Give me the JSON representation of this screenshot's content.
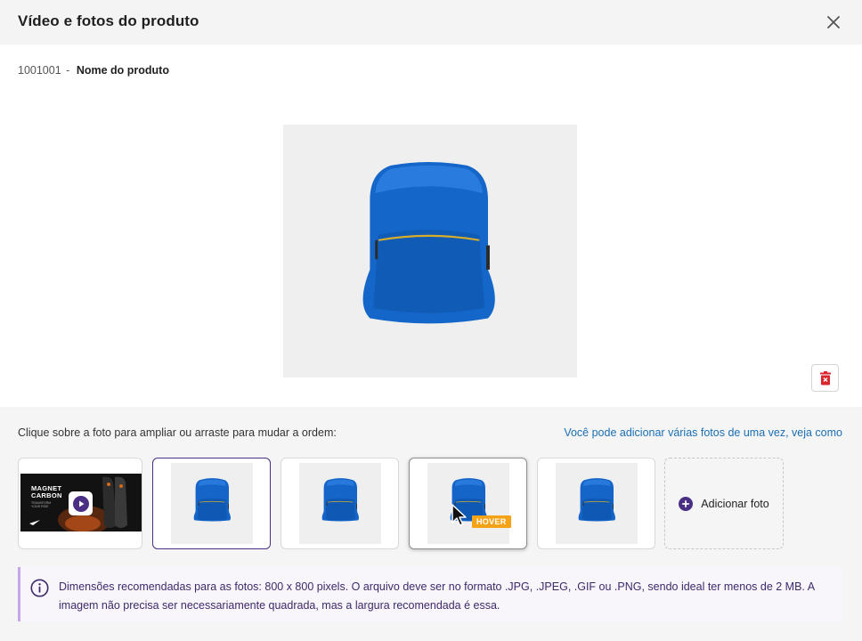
{
  "header": {
    "title": "Vídeo e fotos do produto",
    "close_icon": "close-icon"
  },
  "product": {
    "code": "1001001",
    "separator": "-",
    "name": "Nome do produto"
  },
  "preview": {
    "image": "blue-backpack-photo",
    "delete_icon": "trash-icon"
  },
  "gallery": {
    "instructions": "Clique sobre a foto para ampliar ou arraste para mudar a ordem:",
    "help_link": "Você pode adicionar várias fotos de uma vez, veja como",
    "video": {
      "title_line1": "MAGNET",
      "title_line2": "CARBON",
      "subtitle_line1": "TRANSFORM",
      "subtitle_line2": "YOUR RIDE",
      "play_icon": "play-icon"
    },
    "hover_badge": "HOVER",
    "add_label": "Adicionar foto",
    "add_icon": "plus-circle-icon"
  },
  "info": {
    "icon": "info-icon",
    "text": "Dimensões recomendadas para as fotos: 800 x 800 pixels. O arquivo deve ser no formato .JPG, .JPEG, .GIF ou .PNG, sendo ideal ter menos de 2 MB. A imagem não precisa ser necessariamente quadrada, mas a largura recomendada é essa."
  },
  "colors": {
    "accent": "#4a2f85",
    "link": "#1a6fb5",
    "danger": "#d9262e",
    "hover_badge": "#f4a317",
    "info_border": "#c6a6e3"
  }
}
